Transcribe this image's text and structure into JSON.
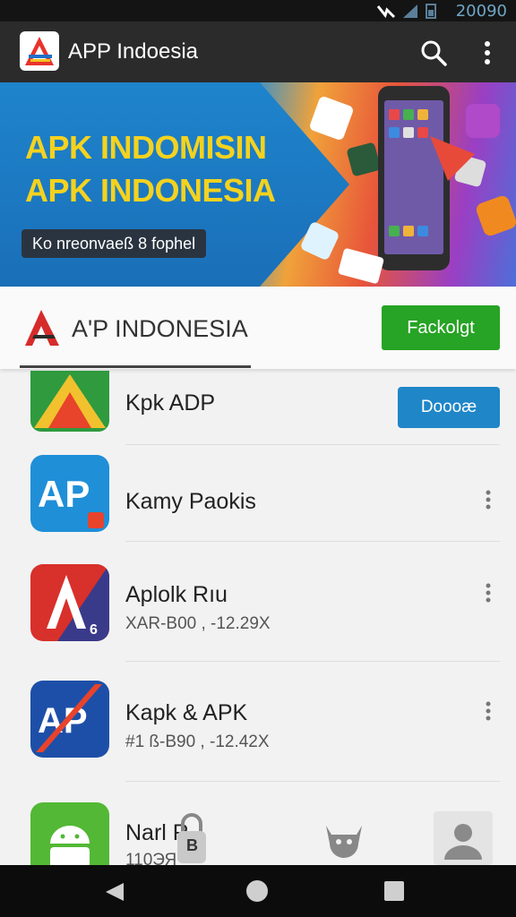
{
  "status_bar": {
    "time": "20090"
  },
  "app_bar": {
    "title": "APP Indoesia",
    "icons": [
      "app-logo-icon",
      "search-icon",
      "more-vert-icon"
    ]
  },
  "banner": {
    "headline_1": "APK INDOMISIN",
    "headline_2": "APK INDONESIA",
    "tagline": "Ko nreonvaeß 8 fophel"
  },
  "brand_row": {
    "brand_text": "A'P INDONESIA",
    "button_label": "Fackolgt"
  },
  "list": [
    {
      "name": "Kpk ADP",
      "subtitle": "",
      "action_label": "Doooæ",
      "icon": "green-triangle-icon"
    },
    {
      "name": "Kamy Paokis",
      "subtitle": "",
      "icon": "ap-blue-icon"
    },
    {
      "name": "Aplolk Rıu",
      "subtitle": "XAR-B00 , -12.29X",
      "icon": "red-a-icon"
    },
    {
      "name": "Kapk & APK",
      "subtitle": "#1 ß-B90 , -12.42X",
      "icon": "ap-stripe-icon"
    },
    {
      "name": "Narl R",
      "subtitle": "110ЭЯ",
      "icon": "android-icon"
    }
  ],
  "bottom_tabs": {
    "tab_1_label": "B",
    "icons": [
      "padlock-icon",
      "robot-head-icon",
      "user-avatar-icon"
    ]
  },
  "colors": {
    "app_bar": "#2b2b2b",
    "banner_yellow": "#f4d21f",
    "green_button": "#27a325",
    "blue_button": "#1f86c8"
  }
}
